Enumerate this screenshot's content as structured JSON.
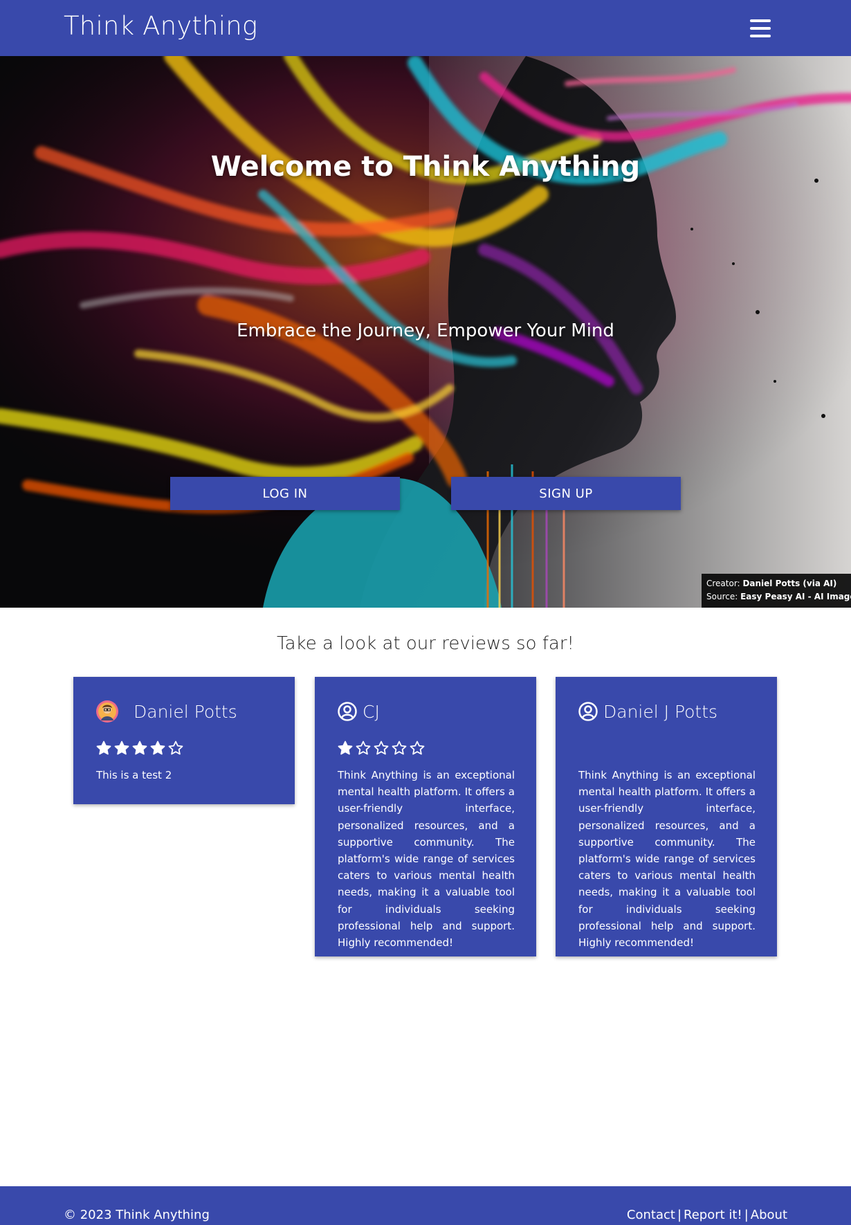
{
  "navbar": {
    "brand": "Think Anything",
    "menu_icon": "hamburger-menu-icon"
  },
  "hero": {
    "title": "Welcome to Think Anything",
    "subtitle": "Embrace the Journey, Empower Your Mind",
    "login_label": "LOG IN",
    "signup_label": "SIGN UP",
    "credit": {
      "creator_label": "Creator:",
      "creator_name": "Daniel Potts (via AI)",
      "source_label": "Source:",
      "source_name": "Easy Peasy AI - AI Images"
    }
  },
  "reviews": {
    "heading": "Take a look at our reviews so far!",
    "items": [
      {
        "name": "Daniel Potts",
        "icon": "avatar-image",
        "rating": 4,
        "text": "This is a test 2"
      },
      {
        "name": "CJ",
        "icon": "user-circle-icon",
        "rating": 1,
        "text": "Think Anything is an exceptional mental health platform. It offers a user-friendly interface, personalized resources, and a supportive community. The platform's wide range of services caters to various mental health needs, making it a valuable tool for individuals seeking professional help and support. Highly recommended!"
      },
      {
        "name": "Daniel J Potts",
        "icon": "user-circle-icon",
        "rating": 0,
        "text": "Think Anything is an exceptional mental health platform. It offers a user-friendly interface, personalized resources, and a supportive community. The platform's wide range of services caters to various mental health needs, making it a valuable tool for individuals seeking professional help and support. Highly recommended!"
      }
    ]
  },
  "footer": {
    "copyright": "© 2023 Think Anything",
    "links": [
      "Contact",
      "Report it!",
      "About"
    ],
    "separator": "|"
  },
  "colors": {
    "primary": "#3949ab",
    "text_on_primary": "#ffffff",
    "page_background": "#ffffff"
  }
}
